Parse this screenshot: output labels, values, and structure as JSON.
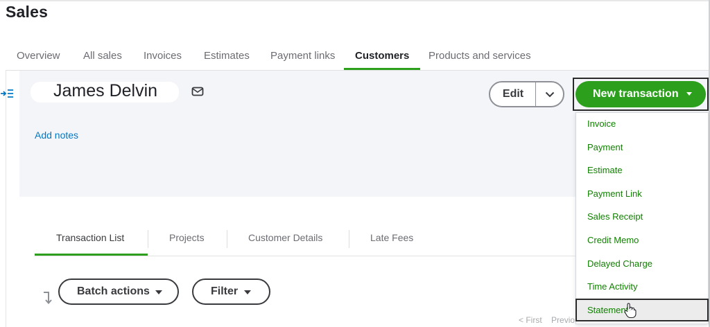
{
  "page": {
    "title": "Sales"
  },
  "tabs": [
    {
      "label": "Overview"
    },
    {
      "label": "All sales"
    },
    {
      "label": "Invoices"
    },
    {
      "label": "Estimates"
    },
    {
      "label": "Payment links"
    },
    {
      "label": "Customers",
      "active": true
    },
    {
      "label": "Products and services"
    }
  ],
  "customer": {
    "name": "James Delvin",
    "add_notes": "Add notes"
  },
  "actions": {
    "edit_label": "Edit",
    "new_transaction_label": "New transaction"
  },
  "new_transaction_menu": {
    "items": [
      {
        "label": "Invoice"
      },
      {
        "label": "Payment"
      },
      {
        "label": "Estimate"
      },
      {
        "label": "Payment Link"
      },
      {
        "label": "Sales Receipt"
      },
      {
        "label": "Credit Memo"
      },
      {
        "label": "Delayed Charge"
      },
      {
        "label": "Time Activity"
      },
      {
        "label": "Statement",
        "hovered": true
      }
    ]
  },
  "subtabs": [
    {
      "label": "Transaction List",
      "active": true
    },
    {
      "label": "Projects"
    },
    {
      "label": "Customer Details"
    },
    {
      "label": "Late Fees"
    }
  ],
  "toolbar": {
    "batch_actions_label": "Batch actions",
    "filter_label": "Filter"
  },
  "pagination": {
    "first_label": "< First",
    "previous_label": "Previo"
  },
  "colors": {
    "brand_green": "#2ca01c",
    "link_blue": "#0077c5",
    "menu_text_green": "#108000"
  }
}
